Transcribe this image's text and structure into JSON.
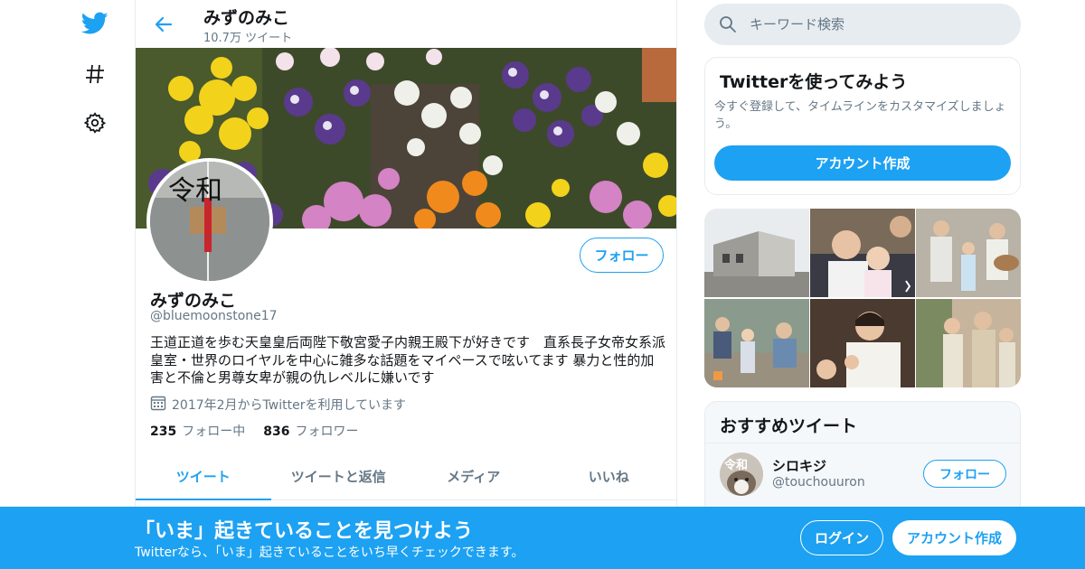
{
  "colors": {
    "accent": "#1da1f2",
    "muted": "#657786",
    "text": "#14171a",
    "border": "#e6ecf0"
  },
  "nav": {
    "icons": [
      "twitter-bird-icon",
      "hashtag-icon",
      "gear-icon"
    ]
  },
  "header": {
    "name": "みずのみこ",
    "tweet_count": "10.7万 ツイート"
  },
  "profile": {
    "name": "みずのみこ",
    "handle": "@bluemoonstone17",
    "bio": "王道正道を歩む天皇皇后両陛下敬宮愛子内親王殿下が好きです　直系長子女帝女系派 皇室・世界のロイヤルを中心に雑多な話題をマイペースで呟いてます 暴力と性的加害と不倫と男尊女卑が親の仇レベルに嫌いです",
    "joined": "2017年2月からTwitterを利用しています",
    "following_count": "235",
    "following_label": "フォロー中",
    "followers_count": "836",
    "followers_label": "フォロワー",
    "follow_button": "フォロー",
    "avatar_text": "令和"
  },
  "tabs": [
    {
      "label": "ツイート",
      "active": true
    },
    {
      "label": "ツイートと返信",
      "active": false
    },
    {
      "label": "メディア",
      "active": false
    },
    {
      "label": "いいね",
      "active": false
    }
  ],
  "search": {
    "placeholder": "キーワード検索"
  },
  "signup_card": {
    "title": "Twitterを使ってみよう",
    "subtitle": "今すぐ登録して、タイムラインをカスタマイズしましょう。",
    "button": "アカウント作成"
  },
  "recommended": {
    "title": "おすすめツイート",
    "user_name": "シロキジ",
    "user_handle": "@touchouuron",
    "avatar_text": "令和",
    "follow_button": "フォロー"
  },
  "bottom_banner": {
    "title": "「いま」起きていることを見つけよう",
    "subtitle": "Twitterなら、「いま」起きていることをいち早くチェックできます。",
    "login": "ログイン",
    "create_account": "アカウント作成"
  }
}
